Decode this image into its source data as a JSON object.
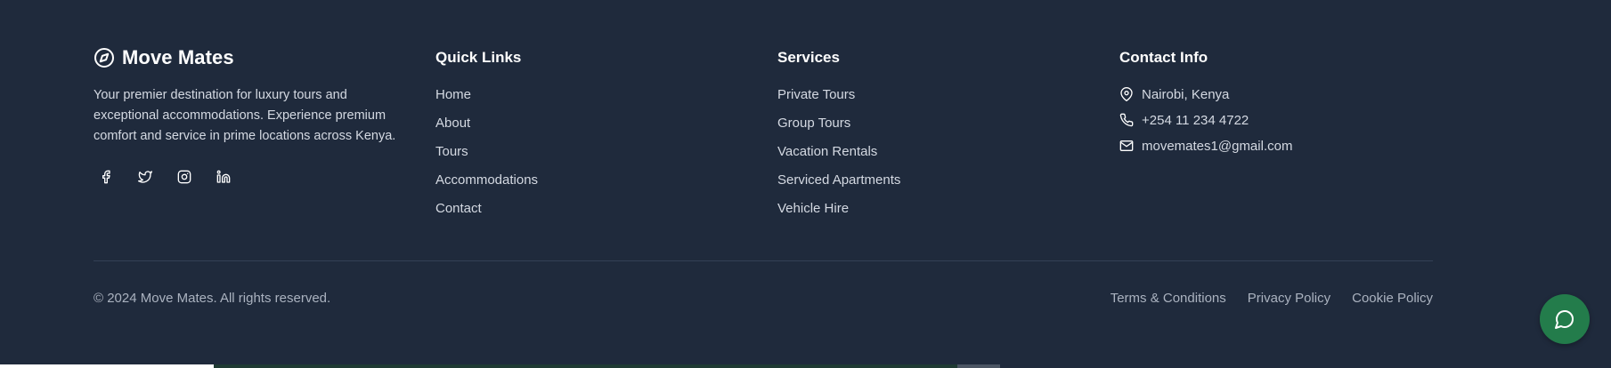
{
  "brand": {
    "name": "Move Mates",
    "icon": "compass-icon",
    "description": "Your premier destination for luxury tours and exceptional accommodations. Experience premium comfort and service in prime locations across Kenya."
  },
  "socials": [
    {
      "name": "facebook-icon"
    },
    {
      "name": "twitter-icon"
    },
    {
      "name": "instagram-icon"
    },
    {
      "name": "linkedin-icon"
    }
  ],
  "quick_links": {
    "title": "Quick Links",
    "items": [
      "Home",
      "About",
      "Tours",
      "Accommodations",
      "Contact"
    ]
  },
  "services": {
    "title": "Services",
    "items": [
      "Private Tours",
      "Group Tours",
      "Vacation Rentals",
      "Serviced Apartments",
      "Vehicle Hire"
    ]
  },
  "contact": {
    "title": "Contact Info",
    "items": [
      {
        "icon": "map-pin-icon",
        "text": "Nairobi, Kenya"
      },
      {
        "icon": "phone-icon",
        "text": "+254 11 234 4722"
      },
      {
        "icon": "mail-icon",
        "text": "movemates1@gmail.com"
      }
    ]
  },
  "bottom": {
    "copyright": "© 2024 Move Mates. All rights reserved.",
    "legal": [
      "Terms & Conditions",
      "Privacy Policy",
      "Cookie Policy"
    ]
  },
  "chat": {
    "icon": "chat-bubble-icon"
  },
  "colors": {
    "background": "#1f2a3c",
    "heading": "#ffffff",
    "text": "#d4d9e2",
    "muted": "#aab2bf",
    "chat_button": "#237c4b"
  }
}
